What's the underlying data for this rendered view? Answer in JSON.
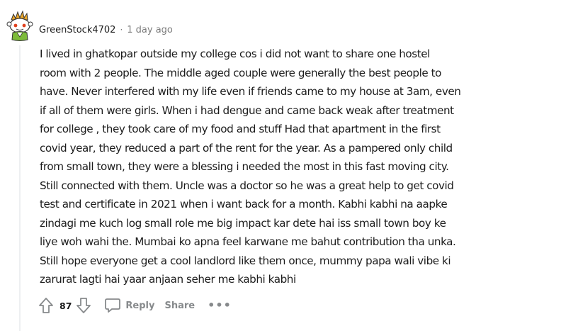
{
  "comment": {
    "author": "GreenStock4702",
    "separator": "·",
    "age": "1 day ago",
    "body_lines": [
      "I lived in ghatkopar outside my college cos i did not want to share one hostel",
      "room with 2 people. The middle aged couple were generally the best people to",
      "have. Never interfered with my life even if friends came to my house at 3am, even",
      "if all of them were girls. When i had dengue and came back weak after treatment",
      "for college , they took care of my food and stuff Had that apartment in the first",
      "covid year, they reduced a part of the rent for the year. As a pampered only child",
      "from small town, they were a blessing i needed the most in this fast moving city.",
      "Still connected with them. Uncle was a doctor so he was a great help to get covid",
      "test and certificate in 2021 when i want back for a month. Kabhi kabhi na aapke",
      "zindagi me kuch log small role me big impact kar dete hai iss small town boy ke",
      "liye woh wahi the. Mumbai ko apna feel karwane me bahut contribution tha unka.",
      "Still hope everyone get a cool landlord like them once, mummy papa wali vibe ki",
      "zarurat lagti hai yaar anjaan seher me kabhi kabhi"
    ]
  },
  "actions": {
    "score": "87",
    "reply_label": "Reply",
    "share_label": "Share",
    "more_label": "•••"
  },
  "icons": {
    "avatar": "snoo-avatar-icon",
    "upvote": "arrow-up-icon",
    "downvote": "arrow-down-icon",
    "reply": "speech-bubble-icon"
  },
  "colors": {
    "text": "#1c1c1c",
    "muted": "#7c7c7c",
    "action": "#878a8c",
    "thread_line": "#edeff1"
  }
}
